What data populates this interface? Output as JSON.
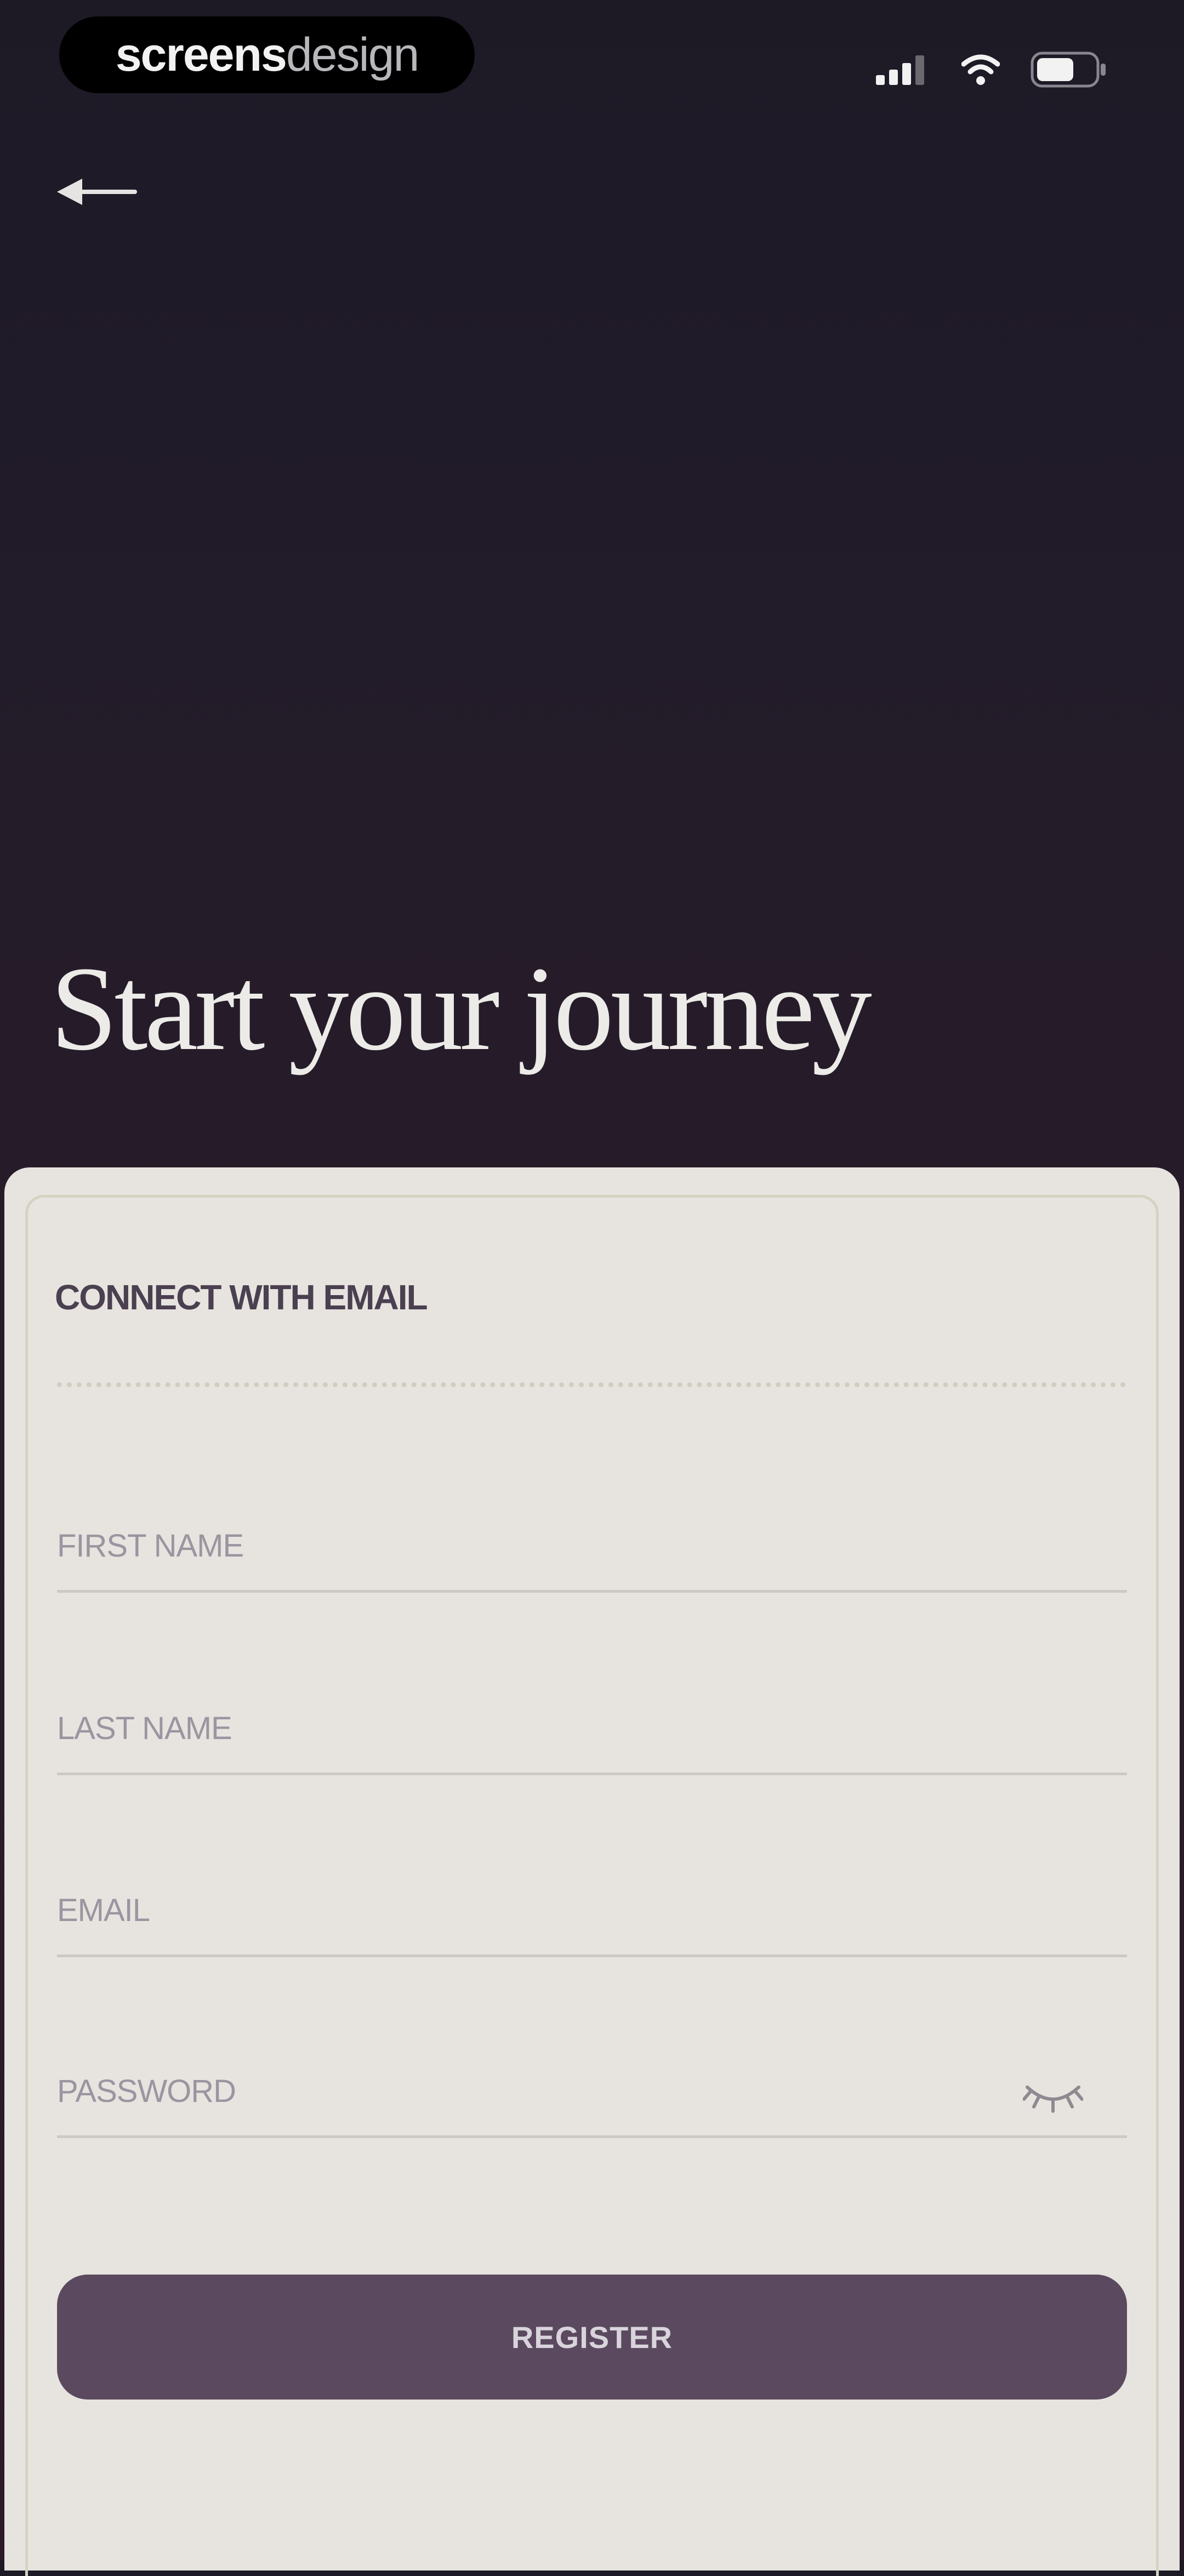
{
  "brand": {
    "part_bold": "screens",
    "part_light": "design"
  },
  "status_bar": {
    "icons": [
      "signal-icon",
      "wifi-icon",
      "battery-icon"
    ]
  },
  "header": {
    "back_icon": "arrow-left-icon"
  },
  "hero": {
    "title": "Start your journey"
  },
  "form": {
    "heading": "CONNECT WITH EMAIL",
    "fields": {
      "first_name": {
        "placeholder": "FIRST NAME",
        "value": ""
      },
      "last_name": {
        "placeholder": "LAST NAME",
        "value": ""
      },
      "email": {
        "placeholder": "EMAIL",
        "value": ""
      },
      "password": {
        "placeholder": "PASSWORD",
        "value": "",
        "toggle_icon": "eye-hidden-icon"
      }
    },
    "submit_label": "REGISTER"
  },
  "colors": {
    "background_top": "#1d1a26",
    "background_bottom": "#2b1b26",
    "card": "#e7e4e0",
    "card_border": "#d4d3c2",
    "button": "#5b4a5f",
    "heading_text": "#4a4050",
    "placeholder_text": "#9b95a0",
    "title_text": "#ecebe8"
  }
}
